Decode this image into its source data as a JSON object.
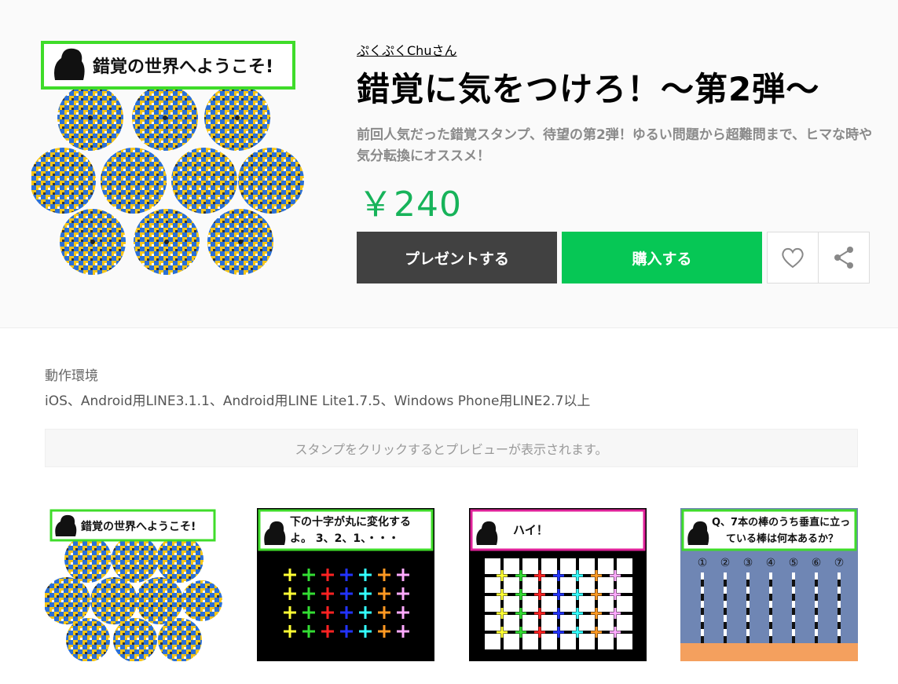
{
  "product": {
    "author": "ぷくぷくChuさん",
    "title": "錯覚に気をつけろ！～第2弾～",
    "description": "前回人気だった錯覚スタンプ、待望の第2弾！ゆるい問題から超難問まで、ヒマな時や気分転換にオススメ！",
    "price": "￥240",
    "main_image_caption": "錯覚の世界へようこそ!"
  },
  "buttons": {
    "present": "プレゼントする",
    "buy": "購入する",
    "like_icon": "heart-icon",
    "share_icon": "share-icon"
  },
  "environment": {
    "label": "動作環境",
    "text": "iOS、Android用LINE3.1.1、Android用LINE Lite1.7.5、Windows Phone用LINE2.7以上"
  },
  "preview_hint": "スタンプをクリックするとプレビューが表示されます。",
  "stickers": [
    {
      "caption": "錯覚の世界へようこそ!"
    },
    {
      "caption_line1": "下の十字が丸に変化する",
      "caption_line2": "よ。 3、2、1、・・・"
    },
    {
      "caption": "ハイ！"
    },
    {
      "caption_line1": "Q、7本の棒のうち垂直に立っ",
      "caption_line2": "ている棒は何本あるか？",
      "numbers": [
        "①",
        "②",
        "③",
        "④",
        "⑤",
        "⑥",
        "⑦"
      ]
    }
  ],
  "colors": {
    "buy_green": "#06c755",
    "present_dark": "#414141",
    "price_green": "#17b35a"
  }
}
